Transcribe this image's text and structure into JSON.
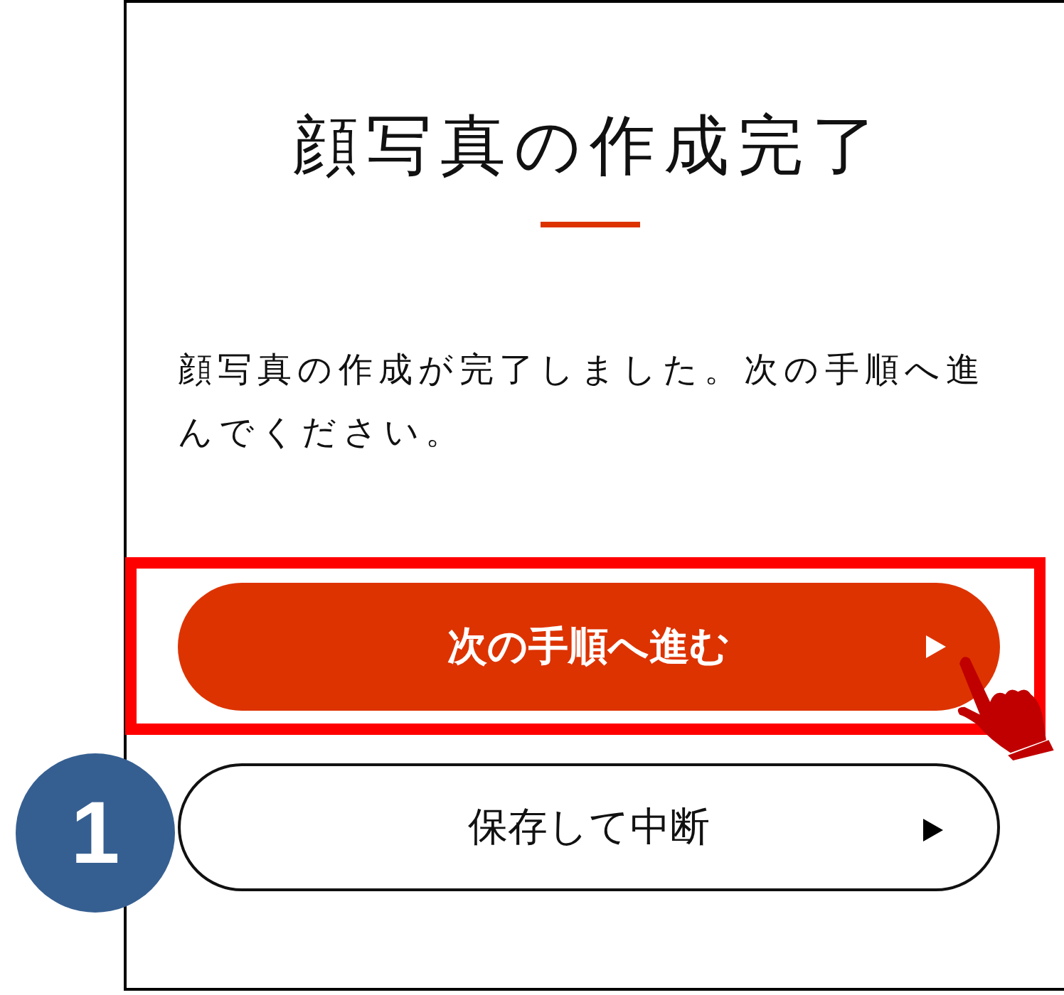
{
  "title": "顔写真の作成完了",
  "message": "顔写真の作成が完了しました。次の手順へ進んでください。",
  "buttons": [
    {
      "label": "次の手順へ進む",
      "kind": "primary",
      "highlighted": true
    },
    {
      "label": "保存して中断",
      "kind": "secondary",
      "highlighted": false
    }
  ],
  "step_badge": "1"
}
